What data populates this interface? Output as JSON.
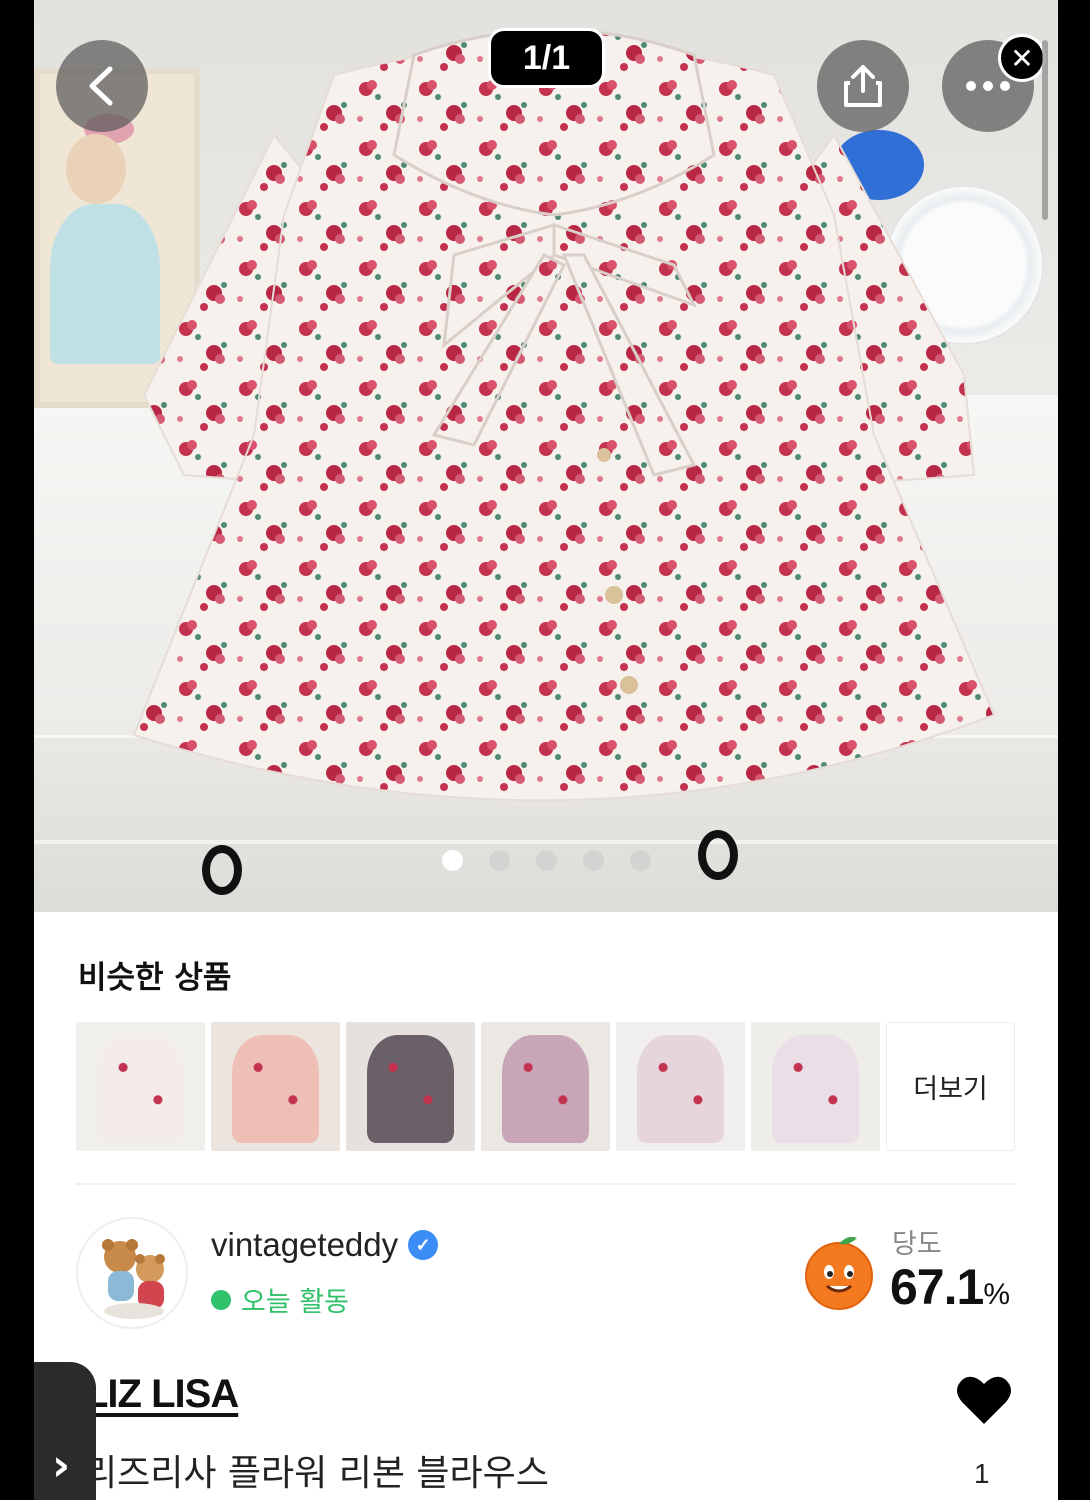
{
  "gallery": {
    "counter": "1/1",
    "dots": [
      true,
      false,
      false,
      false,
      false
    ]
  },
  "similar": {
    "title": "비슷한 상품",
    "more_label": "더보기",
    "thumbnails": [
      {
        "name": "similar-item-1",
        "bg": "#f1efec",
        "dress": "#f4ecea"
      },
      {
        "name": "similar-item-2",
        "bg": "#ece5df",
        "dress": "#eebfb4"
      },
      {
        "name": "similar-item-3",
        "bg": "#e4e1de",
        "dress": "#6b5f68"
      },
      {
        "name": "similar-item-4",
        "bg": "#ebe8e4",
        "dress": "#c9a5b8"
      },
      {
        "name": "similar-item-5",
        "bg": "#f1efed",
        "dress": "#e6d5dc"
      },
      {
        "name": "similar-item-6",
        "bg": "#eeedea",
        "dress": "#eadfe6"
      }
    ]
  },
  "seller": {
    "name": "vintageteddy",
    "status": "오늘 활동",
    "sweetness_label": "당도",
    "sweetness_value": "67.1",
    "sweetness_unit": "%"
  },
  "product": {
    "brand": "LIZ LISA",
    "title": "리즈리사 플라워 리본 블라우스",
    "likes": "1"
  },
  "colors": {
    "accent_green": "#2fc26a",
    "verified_blue": "#3b8cf5"
  }
}
